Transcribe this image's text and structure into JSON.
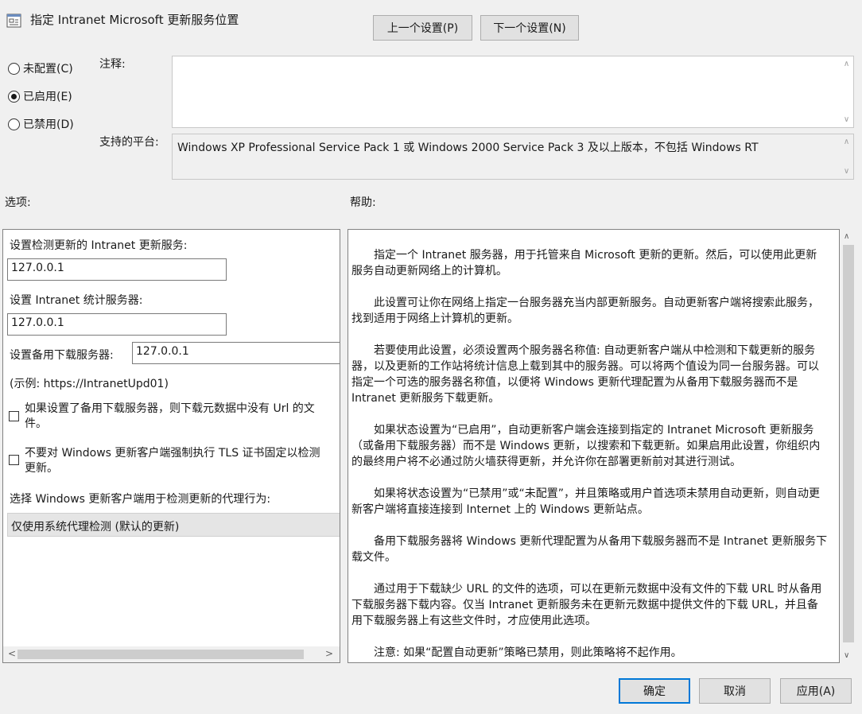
{
  "window": {
    "title": "指定 Intranet Microsoft 更新服务位置",
    "icon": "policy-setting-icon"
  },
  "nav": {
    "prev_label": "上一个设置(P)",
    "next_label": "下一个设置(N)"
  },
  "state": {
    "options": [
      {
        "label": "未配置(C)",
        "selected": false
      },
      {
        "label": "已启用(E)",
        "selected": true
      },
      {
        "label": "已禁用(D)",
        "selected": false
      }
    ]
  },
  "comment": {
    "label": "注释:",
    "value": ""
  },
  "platform": {
    "label": "支持的平台:",
    "value": "Windows XP Professional Service Pack 1 或 Windows 2000 Service Pack 3 及以上版本，不包括 Windows RT"
  },
  "options_section": {
    "title": "选项:",
    "detect_label": "设置检测更新的 Intranet 更新服务:",
    "detect_value": "127.0.0.1",
    "stats_label": "设置 Intranet 统计服务器:",
    "stats_value": "127.0.0.1",
    "alt_label": "设置备用下载服务器:",
    "alt_value": "127.0.0.1",
    "example": "(示例:   https://IntranetUpd01)",
    "checkbox1_line1": "如果设置了备用下载服务器，则下载元数据中没有 Url 的文",
    "checkbox1_line2": "件。",
    "checkbox1_checked": false,
    "checkbox2_line1": "不要对 Windows 更新客户端强制执行 TLS 证书固定以检测",
    "checkbox2_line2": "更新。",
    "checkbox2_checked": false,
    "proxy_label": "选择 Windows 更新客户端用于检测更新的代理行为:",
    "proxy_value": "仅使用系统代理检测 (默认的更新)"
  },
  "help_section": {
    "title": "帮助:",
    "paragraphs": [
      "指定一个 Intranet 服务器，用于托管来自 Microsoft 更新的更新。然后，可以使用此更新服务自动更新网络上的计算机。",
      "此设置可让你在网络上指定一台服务器充当内部更新服务。自动更新客户端将搜索此服务，找到适用于网络上计算机的更新。",
      "若要使用此设置，必须设置两个服务器名称值: 自动更新客户端从中检测和下载更新的服务器，以及更新的工作站将统计信息上载到其中的服务器。可以将两个值设为同一台服务器。可以指定一个可选的服务器名称值，以便将 Windows 更新代理配置为从备用下载服务器而不是 Intranet 更新服务下载更新。",
      "如果状态设置为“已启用”，自动更新客户端会连接到指定的 Intranet Microsoft 更新服务（或备用下载服务器）而不是 Windows 更新，以搜索和下载更新。如果启用此设置，你组织内的最终用户将不必通过防火墙获得更新，并允许你在部署更新前对其进行测试。",
      "如果将状态设置为“已禁用”或“未配置”，并且策略或用户首选项未禁用自动更新，则自动更新客户端将直接连接到 Internet 上的 Windows 更新站点。",
      "备用下载服务器将 Windows 更新代理配置为从备用下载服务器而不是 Intranet 更新服务下载文件。",
      "通过用于下载缺少 URL 的文件的选项，可以在更新元数据中没有文件的下载 URL 时从备用下载服务器下载内容。仅当 Intranet 更新服务未在更新元数据中提供文件的下载 URL，并且备用下载服务器上有这些文件时，才应使用此选项。",
      "注意: 如果“配置自动更新”策略已禁用，则此策略将不起作用。"
    ]
  },
  "footer": {
    "ok_label": "确定",
    "cancel_label": "取消",
    "apply_label": "应用(A)"
  }
}
